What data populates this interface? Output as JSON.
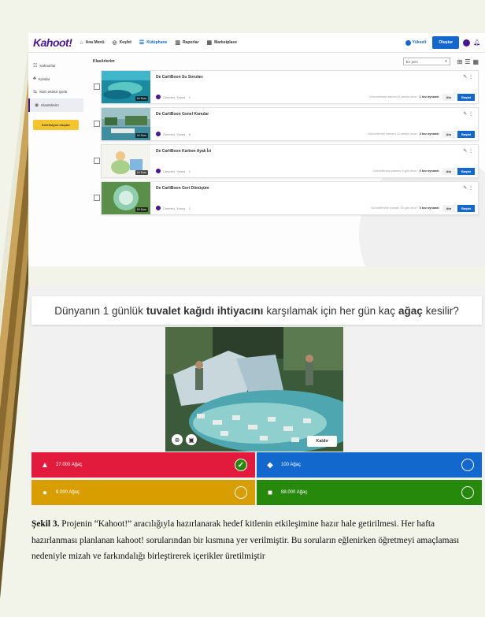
{
  "kahoot_library": {
    "logo": "Kahoot!",
    "nav": [
      {
        "icon": "⌂",
        "label": "Ana Menü"
      },
      {
        "icon": "◎",
        "label": "Keşfet"
      },
      {
        "icon": "☰",
        "label": "Kütüphane"
      },
      {
        "icon": "▥",
        "label": "Raporlar"
      },
      {
        "icon": "▦",
        "label": "Marketplace"
      }
    ],
    "upgrade_label": "Yükselt",
    "create_label": "Oluştur",
    "sidebar": [
      {
        "icon": "☷",
        "label": "Kahoot'lar"
      },
      {
        "icon": "♣",
        "label": "Kurslar"
      },
      {
        "icon": "⇆",
        "label": "Sizin ekinizi içerik"
      },
      {
        "icon": "◉",
        "label": "Klasörlerim"
      }
    ],
    "new_collection_label": "Koleksiyon oluştur",
    "section_title": "Klasörlerim",
    "sort_value": "En yeni",
    "cards": [
      {
        "title": "De CarliBoon Su Soruları",
        "owner": "Cemreci_Yunus",
        "count": "1",
        "updated": "Güncellenme zamanı 5 saniye önce",
        "plays": "1 kez oynandı",
        "badge": "16 Soru"
      },
      {
        "title": "De CarliBoon Genel Konular",
        "owner": "Cemreci_Yunus",
        "count": "6",
        "updated": "Güncellenme zamanı 12 saniye önce",
        "plays": "3 kez oynandı",
        "badge": "16 Soru"
      },
      {
        "title": "De CarliBoon Karbon Ayak İzi",
        "owner": "Cemreci_Yunus",
        "count": "1",
        "updated": "Güncellenme zamanı 3 gün önce",
        "plays": "0 kez oynandı",
        "badge": "16 Soru"
      },
      {
        "title": "De CarliBoon Geri Dönüşüm",
        "owner": "Cemreci_Yunus",
        "count": "1",
        "updated": "Güncellenme zamanı 18 gün önce",
        "plays": "0 kez oynandı",
        "badge": "16 Soru"
      }
    ],
    "assign_label": "Ata",
    "start_label": "Başlat"
  },
  "question": {
    "pre": "Dünyanın 1 günlük",
    "bold1": "tuvalet kağıdı ihtiyacını",
    "mid": "karşılamak için her gün kaç",
    "bold2": "ağaç",
    "post": "kesilir?",
    "remove_label": "Kaldır",
    "answers": [
      {
        "shape": "▲",
        "text": "27.000 Ağaç",
        "color": "#e21b3c",
        "correct": true
      },
      {
        "shape": "◆",
        "text": "100 Ağaç",
        "color": "#1368ce",
        "correct": false
      },
      {
        "shape": "●",
        "text": "8.000 Ağaç",
        "color": "#d89e00",
        "correct": false
      },
      {
        "shape": "■",
        "text": "88.000 Ağaç",
        "color": "#26890c",
        "correct": false
      }
    ]
  },
  "caption": {
    "label": "Şekil 3.",
    "text": " Projenin “Kahoot!” aracılığıyla hazırlanarak hedef kitlenin etkileşimine hazır hale getirilmesi. Her hafta hazırlanması planlanan kahoot! sorularından bir kısmına yer verilmiştir. Bu soruların eğlenirken öğretmeyi amaçlaması nedeniyle mizah ve farkındalığı birleştirerek içerikler üretilmiştir"
  }
}
